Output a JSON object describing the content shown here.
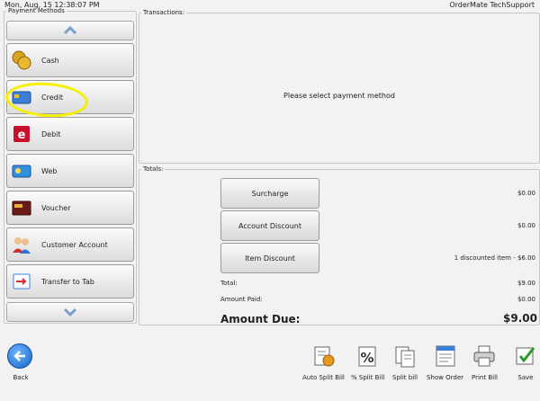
{
  "topbar": {
    "datetime": "Mon, Aug, 15 12:38:07 PM",
    "user": "OrderMate TechSupport"
  },
  "payment_methods": {
    "legend": "Payment Methods",
    "items": [
      {
        "label": "Cash",
        "icon": "coins-icon"
      },
      {
        "label": "Credit",
        "icon": "credit-card-icon"
      },
      {
        "label": "Debit",
        "icon": "eftpos-icon"
      },
      {
        "label": "Web",
        "icon": "web-card-icon"
      },
      {
        "label": "Voucher",
        "icon": "voucher-icon"
      },
      {
        "label": "Customer Account",
        "icon": "customers-icon"
      },
      {
        "label": "Transfer to Tab",
        "icon": "transfer-icon"
      }
    ]
  },
  "transactions": {
    "legend": "Transactions:",
    "message": "Please select payment method"
  },
  "totals": {
    "legend": "Totals:",
    "buttons": [
      {
        "label": "Surcharge",
        "value": "$0.00"
      },
      {
        "label": "Account Discount",
        "value": "$0.00"
      },
      {
        "label": "Item Discount",
        "value": "1 discounted item - $6.00"
      }
    ],
    "total_label": "Total:",
    "total_value": "$9.00",
    "paid_label": "Amount Paid:",
    "paid_value": "$0.00",
    "due_label": "Amount Due:",
    "due_value": "$9.00"
  },
  "toolbar": {
    "back_label": "Back",
    "tools": [
      {
        "label": "Auto Split Bill",
        "icon": "auto-split-icon"
      },
      {
        "label": "% Split Bill",
        "icon": "percent-split-icon"
      },
      {
        "label": "Split bill",
        "icon": "split-bill-icon"
      },
      {
        "label": "Show Order",
        "icon": "show-order-icon"
      },
      {
        "label": "Print Bill",
        "icon": "printer-icon"
      },
      {
        "label": "Save",
        "icon": "save-icon"
      }
    ]
  },
  "colors": {
    "highlight": "#f5f000",
    "back_blue": "#1463c8"
  }
}
